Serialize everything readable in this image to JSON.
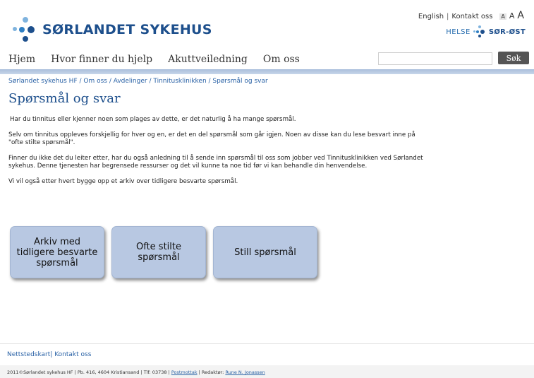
{
  "header": {
    "logo_text": "SØRLANDET SYKEHUS",
    "top_links": {
      "english": "English",
      "sep": "|",
      "contact": "Kontakt oss"
    },
    "font_size": {
      "small": "A",
      "medium": "A",
      "large": "A"
    },
    "helse_left": "HELSE",
    "helse_right": "SØR-ØST",
    "brand_color": "#1d4f8c"
  },
  "nav": {
    "items": [
      {
        "label": "Hjem"
      },
      {
        "label": "Hvor finner du hjelp"
      },
      {
        "label": "Akuttveiledning"
      },
      {
        "label": "Om oss"
      }
    ],
    "search_value": "",
    "search_button": "Søk"
  },
  "main": {
    "breadcrumb": "Sørlandet sykehus HF / Om oss / Avdelinger / Tinnitusklinikken / Spørsmål og svar",
    "title": "Spørsmål og svar",
    "paragraphs": [
      "Har du tinnitus eller kjenner noen som plages av dette, er det naturlig å ha mange spørsmål.",
      "Selv om tinnitus oppleves forskjellig for hver og en, er det en del spørsmål som går igjen. Noen av disse kan du lese besvart inne på \"ofte stilte spørsmål\".",
      "Finner du ikke det du leiter etter, har du også anledning til å sende inn spørsmål til oss som jobber ved Tinnitusklinikken ved Sørlandet sykehus. Denne tjenesten har begrensede ressurser og det vil kunne ta noe tid før vi kan behandle din henvendelse.",
      "Vi vil også etter hvert bygge opp et arkiv over tidligere besvarte spørsmål."
    ],
    "buttons": [
      {
        "label": "Arkiv med tidligere besvarte spørsmål"
      },
      {
        "label": "Ofte stilte spørsmål"
      },
      {
        "label": "Still spørsmål"
      }
    ]
  },
  "footer": {
    "sitemap": "Nettstedskart",
    "sep": "|",
    "contact": "Kontakt oss",
    "info_prefix": "2011©Sørlandet sykehus HF | Pb. 416, 4604 Kristiansand | Tlf: 03738 |",
    "postmottak": "Postmottak",
    "editor_prefix": "| Redaktør:",
    "editor": "Rune N. Jonassen"
  }
}
